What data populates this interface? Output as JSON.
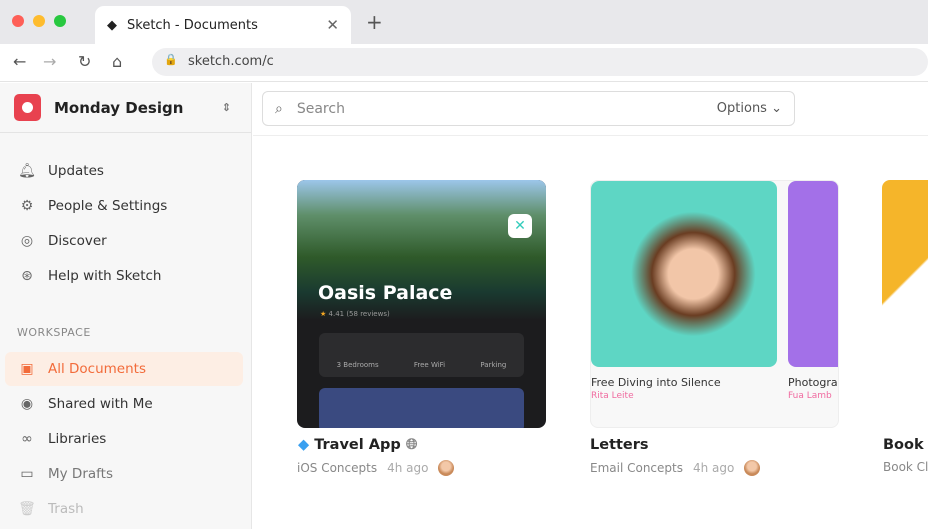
{
  "browser": {
    "tab_title": "Sketch - Documents",
    "url": "sketch.com/c"
  },
  "sidebar": {
    "org": "Monday Design",
    "items": [
      {
        "label": "Updates",
        "icon": "bell-icon"
      },
      {
        "label": "People & Settings",
        "icon": "gear-icon"
      },
      {
        "label": "Discover",
        "icon": "compass-icon"
      },
      {
        "label": "Help with Sketch",
        "icon": "lifebuoy-icon"
      }
    ],
    "section": "WORKSPACE",
    "workspace": [
      {
        "label": "All Documents",
        "icon": "documents-icon",
        "active": true
      },
      {
        "label": "Shared with Me",
        "icon": "user-icon"
      },
      {
        "label": "Libraries",
        "icon": "libraries-icon"
      },
      {
        "label": "My Drafts",
        "icon": "drafts-icon"
      },
      {
        "label": "Trash",
        "icon": "trash-icon"
      }
    ]
  },
  "search": {
    "placeholder": "Search",
    "options": "Options"
  },
  "documents": [
    {
      "title": "Travel App",
      "project": "iOS Concepts",
      "time": "4h ago",
      "preview": {
        "heading": "Oasis Palace",
        "rating": "4.41 (58 reviews)",
        "features": [
          "3 Bedrooms",
          "Free WiFi",
          "Parking"
        ]
      }
    },
    {
      "title": "Letters",
      "project": "Email Concepts",
      "time": "4h ago",
      "preview": {
        "caption1": "Free Diving into Silence",
        "author1": "Rita Leite",
        "caption2": "Photogra",
        "author2": "Fua Lamb"
      }
    },
    {
      "title": "Book C",
      "project": "Book Cl"
    }
  ],
  "colors": {
    "accent": "#f26b3a",
    "brand": "#e8424f"
  }
}
